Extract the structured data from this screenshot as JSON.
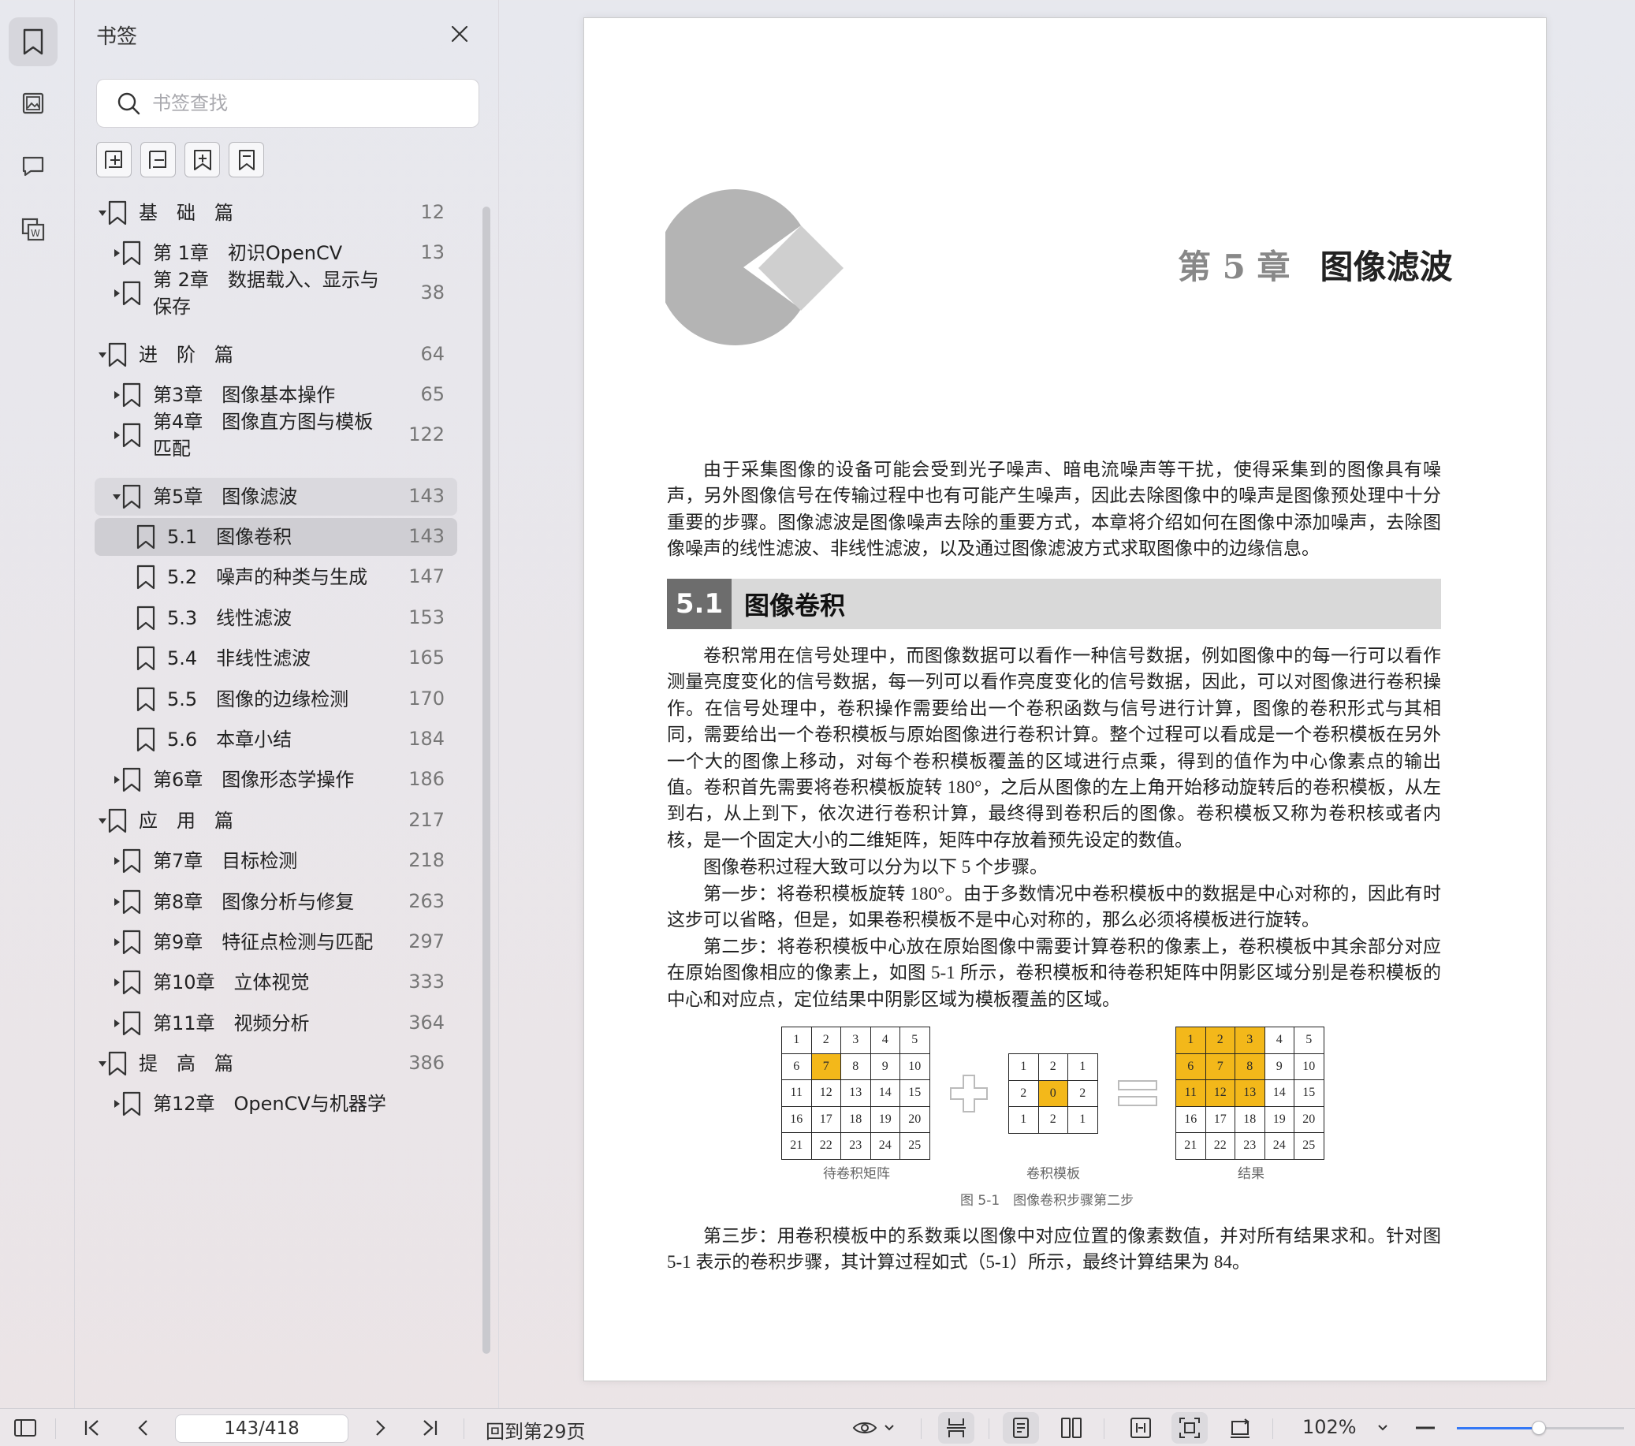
{
  "panel": {
    "title": "书签",
    "search_placeholder": "书签查找",
    "tools": [
      "add-child-icon",
      "collapse-all-icon",
      "add-bookmark-icon",
      "bookmark-icon"
    ]
  },
  "toc": [
    {
      "level": 0,
      "label": "基　础　篇",
      "page": "12",
      "tri": "down"
    },
    {
      "level": 1,
      "label": "第 1章　初识OpenCV",
      "page": "13",
      "tri": "right"
    },
    {
      "level": 1,
      "label": "第 2章　数据载入、显示与\n保存",
      "page": "38",
      "tri": "right"
    },
    {
      "level": 0,
      "label": "进　阶　篇",
      "page": "64",
      "tri": "down"
    },
    {
      "level": 1,
      "label": "第3章　图像基本操作",
      "page": "65",
      "tri": "right"
    },
    {
      "level": 1,
      "label": "第4章　图像直方图与模板\n匹配",
      "page": "122",
      "tri": "right"
    },
    {
      "level": 1,
      "label": "第5章　图像滤波",
      "page": "143",
      "tri": "down",
      "state": "sel"
    },
    {
      "level": 2,
      "label": "5.1　图像卷积",
      "page": "143",
      "state": "cur"
    },
    {
      "level": 2,
      "label": "5.2　噪声的种类与生成",
      "page": "147"
    },
    {
      "level": 2,
      "label": "5.3　线性滤波",
      "page": "153"
    },
    {
      "level": 2,
      "label": "5.4　非线性滤波",
      "page": "165"
    },
    {
      "level": 2,
      "label": "5.5　图像的边缘检测",
      "page": "170"
    },
    {
      "level": 2,
      "label": "5.6　本章小结",
      "page": "184"
    },
    {
      "level": 1,
      "label": "第6章　图像形态学操作",
      "page": "186",
      "tri": "right"
    },
    {
      "level": 0,
      "label": "应　用　篇",
      "page": "217",
      "tri": "down"
    },
    {
      "level": 1,
      "label": "第7章　目标检测",
      "page": "218",
      "tri": "right"
    },
    {
      "level": 1,
      "label": "第8章　图像分析与修复",
      "page": "263",
      "tri": "right"
    },
    {
      "level": 1,
      "label": "第9章　特征点检测与匹配",
      "page": "297",
      "tri": "right"
    },
    {
      "level": 1,
      "label": "第10章　立体视觉",
      "page": "333",
      "tri": "right"
    },
    {
      "level": 1,
      "label": "第11章　视频分析",
      "page": "364",
      "tri": "right"
    },
    {
      "level": 0,
      "label": "提　高　篇",
      "page": "386",
      "tri": "down"
    },
    {
      "level": 1,
      "label": "第12章　OpenCV与机器学",
      "page": "",
      "tri": "right"
    }
  ],
  "document": {
    "chapter_num": "第 5 章",
    "chapter_title": "图像滤波",
    "intro": "由于采集图像的设备可能会受到光子噪声、暗电流噪声等干扰，使得采集到的图像具有噪声，另外图像信号在传输过程中也有可能产生噪声，因此去除图像中的噪声是图像预处理中十分重要的步骤。图像滤波是图像噪声去除的重要方式，本章将介绍如何在图像中添加噪声，去除图像噪声的线性滤波、非线性滤波，以及通过图像滤波方式求取图像中的边缘信息。",
    "section_num": "5.1",
    "section_title": "图像卷积",
    "p1": "卷积常用在信号处理中，而图像数据可以看作一种信号数据，例如图像中的每一行可以看作测量亮度变化的信号数据，每一列可以看作亮度变化的信号数据，因此，可以对图像进行卷积操作。在信号处理中，卷积操作需要给出一个卷积函数与信号进行计算，图像的卷积形式与其相同，需要给出一个卷积模板与原始图像进行卷积计算。整个过程可以看成是一个卷积模板在另外一个大的图像上移动，对每个卷积模板覆盖的区域进行点乘，得到的值作为中心像素点的输出值。卷积首先需要将卷积模板旋转 180°，之后从图像的左上角开始移动旋转后的卷积模板，从左到右，从上到下，依次进行卷积计算，最终得到卷积后的图像。卷积模板又称为卷积核或者内核，是一个固定大小的二维矩阵，矩阵中存放着预先设定的数值。",
    "p2": "图像卷积过程大致可以分为以下 5 个步骤。",
    "p3": "第一步：将卷积模板旋转 180°。由于多数情况中卷积模板中的数据是中心对称的，因此有时这步可以省略，但是，如果卷积模板不是中心对称的，那么必须将模板进行旋转。",
    "p4": "第二步：将卷积模板中心放在原始图像中需要计算卷积的像素上，卷积模板中其余部分对应在原始图像相应的像素上，如图 5-1 所示，卷积模板和待卷积矩阵中阴影区域分别是卷积模板的中心和对应点，定位结果中阴影区域为模板覆盖的区域。",
    "figure": {
      "m1": [
        [
          "1",
          "2",
          "3",
          "4",
          "5"
        ],
        [
          "6",
          "7",
          "8",
          "9",
          "10"
        ],
        [
          "11",
          "12",
          "13",
          "14",
          "15"
        ],
        [
          "16",
          "17",
          "18",
          "19",
          "20"
        ],
        [
          "21",
          "22",
          "23",
          "24",
          "25"
        ]
      ],
      "m1_highlight": [
        [
          1,
          1
        ]
      ],
      "kernel": [
        [
          "1",
          "2",
          "1"
        ],
        [
          "2",
          "0",
          "2"
        ],
        [
          "1",
          "2",
          "1"
        ]
      ],
      "kernel_highlight": [
        [
          1,
          1
        ]
      ],
      "m3": [
        [
          "1",
          "2",
          "3",
          "4",
          "5"
        ],
        [
          "6",
          "7",
          "8",
          "9",
          "10"
        ],
        [
          "11",
          "12",
          "13",
          "14",
          "15"
        ],
        [
          "16",
          "17",
          "18",
          "19",
          "20"
        ],
        [
          "21",
          "22",
          "23",
          "24",
          "25"
        ]
      ],
      "m3_highlight": [
        [
          0,
          0
        ],
        [
          0,
          1
        ],
        [
          0,
          2
        ],
        [
          1,
          0
        ],
        [
          1,
          1
        ],
        [
          1,
          2
        ],
        [
          2,
          0
        ],
        [
          2,
          1
        ],
        [
          2,
          2
        ]
      ],
      "label1": "待卷积矩阵",
      "label2": "卷积模板",
      "label3": "结果",
      "caption": "图 5-1　图像卷积步骤第二步",
      "highlight_color": "#f3b81a"
    },
    "p5": "第三步：用卷积模板中的系数乘以图像中对应位置的像素数值，并对所有结果求和。针对图 5-1 表示的卷积步骤，其计算过程如式（5-1）所示，最终计算结果为 84。"
  },
  "statusbar": {
    "page_value": "143/418",
    "goto_text": "回到第29页",
    "zoom": "102%",
    "zoom_fraction": 0.49,
    "accent_color": "#3478f6"
  }
}
